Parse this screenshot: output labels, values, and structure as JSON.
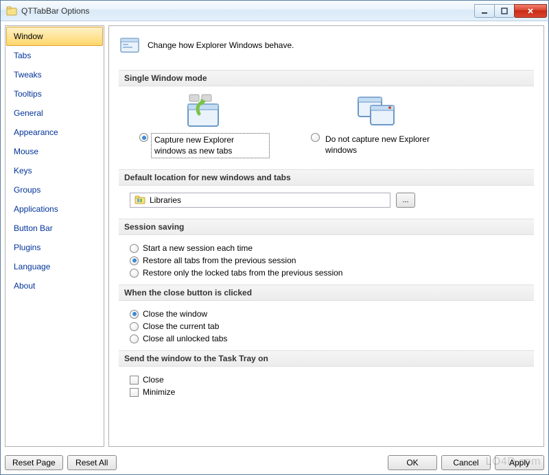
{
  "window": {
    "title": "QTTabBar Options"
  },
  "sidebar": {
    "items": [
      {
        "label": "Window",
        "selected": true
      },
      {
        "label": "Tabs",
        "selected": false
      },
      {
        "label": "Tweaks",
        "selected": false
      },
      {
        "label": "Tooltips",
        "selected": false
      },
      {
        "label": "General",
        "selected": false
      },
      {
        "label": "Appearance",
        "selected": false
      },
      {
        "label": "Mouse",
        "selected": false
      },
      {
        "label": "Keys",
        "selected": false
      },
      {
        "label": "Groups",
        "selected": false
      },
      {
        "label": "Applications",
        "selected": false
      },
      {
        "label": "Button Bar",
        "selected": false
      },
      {
        "label": "Plugins",
        "selected": false
      },
      {
        "label": "Language",
        "selected": false
      },
      {
        "label": "About",
        "selected": false
      }
    ]
  },
  "main": {
    "header_text": "Change how Explorer Windows behave.",
    "sections": {
      "single_window": {
        "title": "Single Window mode",
        "option_capture": "Capture new Explorer windows as new tabs",
        "option_nocapture": "Do not capture new Explorer windows",
        "selected": "capture"
      },
      "default_location": {
        "title": "Default location for new windows and tabs",
        "value": "Libraries",
        "browse_label": "..."
      },
      "session_saving": {
        "title": "Session saving",
        "options": [
          {
            "label": "Start a new session each time",
            "checked": false
          },
          {
            "label": "Restore all tabs from the previous session",
            "checked": true
          },
          {
            "label": "Restore only the locked tabs from the previous session",
            "checked": false
          }
        ]
      },
      "close_button": {
        "title": "When the close button is clicked",
        "options": [
          {
            "label": "Close the window",
            "checked": true
          },
          {
            "label": "Close the current tab",
            "checked": false
          },
          {
            "label": "Close all unlocked tabs",
            "checked": false
          }
        ]
      },
      "task_tray": {
        "title": "Send the window to the Task Tray on",
        "options": [
          {
            "label": "Close",
            "checked": false
          },
          {
            "label": "Minimize",
            "checked": false
          }
        ]
      }
    }
  },
  "footer": {
    "reset_page": "Reset Page",
    "reset_all": "Reset All",
    "ok": "OK",
    "cancel": "Cancel",
    "apply": "Apply"
  },
  "watermark": "LO4D.com"
}
